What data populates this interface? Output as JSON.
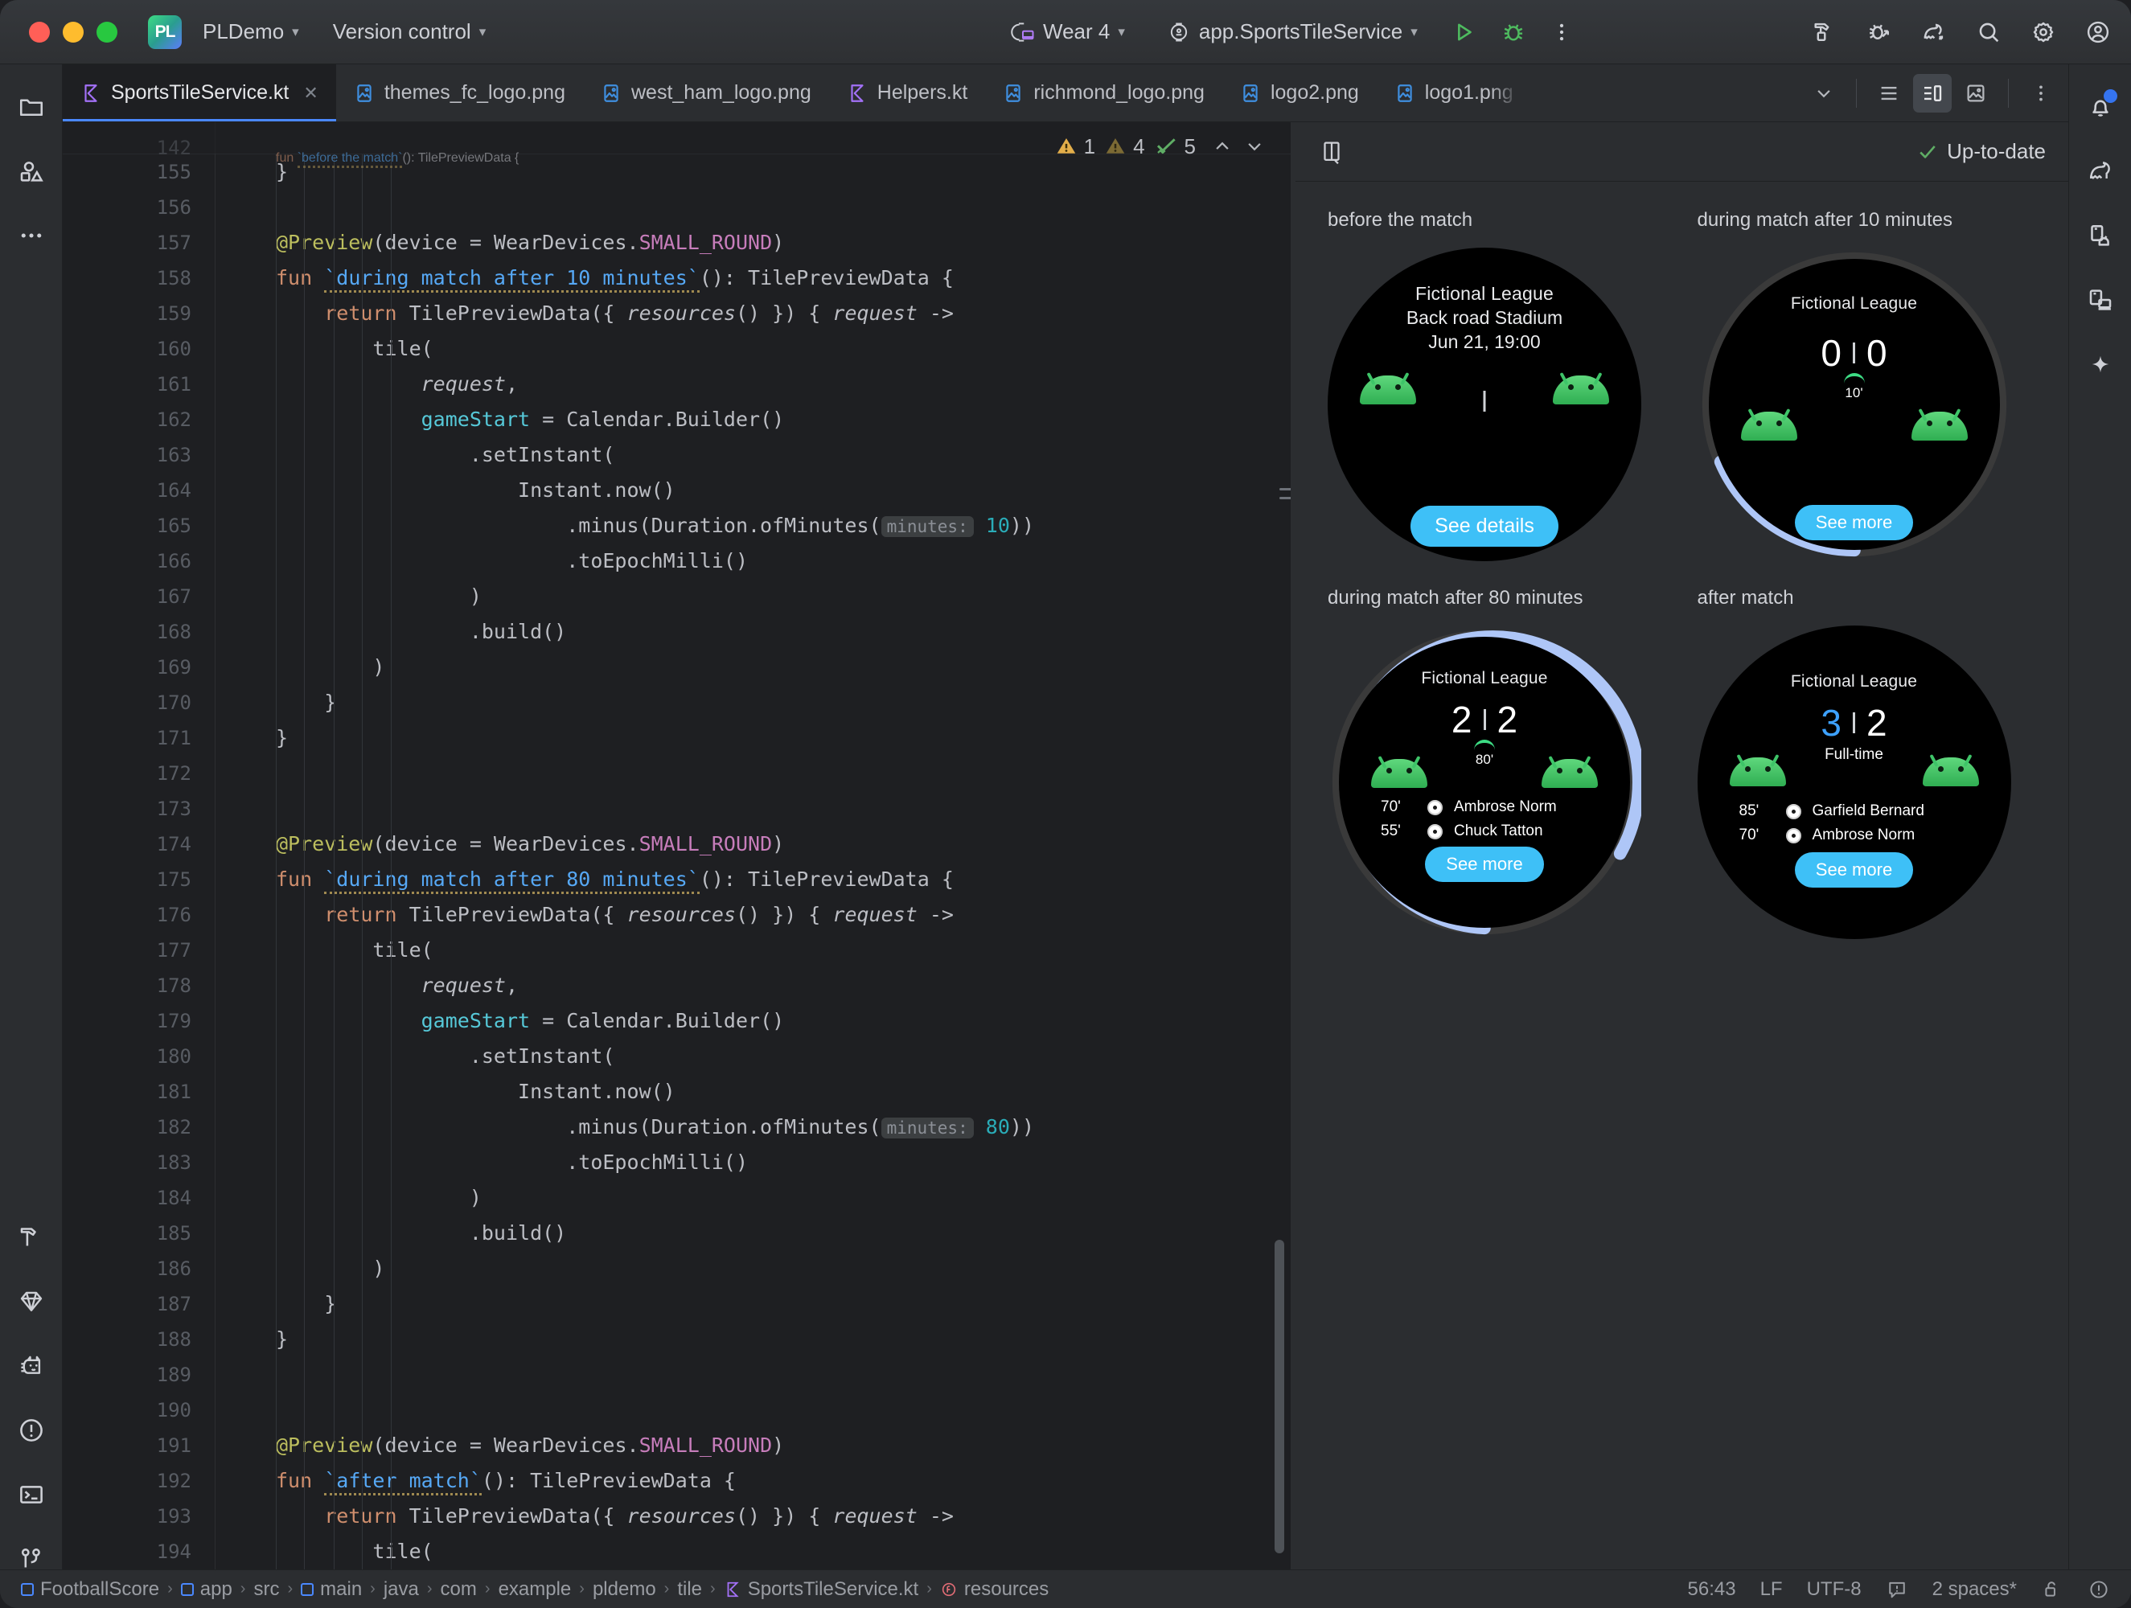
{
  "titlebar": {
    "project_badge": "PL",
    "project_name": "PLDemo",
    "vcs": "Version control",
    "device": "Wear 4",
    "run_config": "app.SportsTileService",
    "icons": {
      "run": "run-icon",
      "debug": "debug-icon",
      "more": "more-vertical-icon",
      "build": "build-hammer-icon",
      "attach_debugger": "attach-debugger-icon",
      "profiler": "profiler-icon",
      "search": "search-icon",
      "settings": "gear-icon",
      "account": "account-icon"
    }
  },
  "left_rail": {
    "top": [
      {
        "name": "project-folder-icon",
        "label": "Project"
      },
      {
        "name": "resource-manager-icon",
        "label": "Resource Manager"
      },
      {
        "name": "more-dots-icon",
        "label": "More tool windows"
      }
    ],
    "bottom": [
      {
        "name": "build-hammer-icon",
        "label": "Build"
      },
      {
        "name": "gemini-diamond-icon",
        "label": "Gemini"
      },
      {
        "name": "logcat-cat-icon",
        "label": "Logcat"
      },
      {
        "name": "problems-warning-icon",
        "label": "Problems"
      },
      {
        "name": "terminal-icon",
        "label": "Terminal"
      },
      {
        "name": "version-control-branch-icon",
        "label": "Version Control"
      }
    ]
  },
  "right_rail": [
    {
      "name": "notifications-bell-icon",
      "label": "Notifications",
      "badge": true
    },
    {
      "name": "profiler-icon",
      "label": "Profiler"
    },
    {
      "name": "device-manager-icon",
      "label": "Device Manager"
    },
    {
      "name": "running-devices-icon",
      "label": "Running Devices"
    },
    {
      "name": "gemini-sparkle-icon",
      "label": "Gemini"
    }
  ],
  "tabs": [
    {
      "label": "SportsTileService.kt",
      "icon": "kotlin-file-icon",
      "active": true,
      "closable": true
    },
    {
      "label": "themes_fc_logo.png",
      "icon": "image-file-icon",
      "active": false,
      "closable": false
    },
    {
      "label": "west_ham_logo.png",
      "icon": "image-file-icon",
      "active": false,
      "closable": false
    },
    {
      "label": "Helpers.kt",
      "icon": "kotlin-file-icon",
      "active": false,
      "closable": false
    },
    {
      "label": "richmond_logo.png",
      "icon": "image-file-icon",
      "active": false,
      "closable": false
    },
    {
      "label": "logo2.png",
      "icon": "image-file-icon",
      "active": false,
      "closable": false
    },
    {
      "label": "logo1.png",
      "icon": "image-file-icon",
      "active": false,
      "closable": false
    }
  ],
  "tabbar_tools": {
    "overflow": "chevron-down-icon",
    "list_view": "list-view-icon",
    "split_view": "split-editor-icon",
    "design_view": "design-preview-icon",
    "more": "more-vertical-icon"
  },
  "editor": {
    "inspections": {
      "warnings_high": "1",
      "warnings_low": "4",
      "checks": "5",
      "up_arrow": "chevron-up-icon",
      "down_arrow": "chevron-down-icon"
    },
    "sticky_line": "142",
    "sticky_text": "fun `before the match`(): TilePreviewData {",
    "lines": [
      {
        "n": "155",
        "t": "}"
      },
      {
        "n": "156",
        "t": ""
      },
      {
        "n": "157",
        "t": "@Preview(device = WearDevices.SMALL_ROUND)"
      },
      {
        "n": "158",
        "t": "fun `during match after 10 minutes`(): TilePreviewData {"
      },
      {
        "n": "159",
        "t": "  return TilePreviewData({ resources() }) { request ->"
      },
      {
        "n": "160",
        "t": "    tile("
      },
      {
        "n": "161",
        "t": "      request,"
      },
      {
        "n": "162",
        "t": "      gameStart = Calendar.Builder()"
      },
      {
        "n": "163",
        "t": "        .setInstant("
      },
      {
        "n": "164",
        "t": "          Instant.now()"
      },
      {
        "n": "165",
        "t": "            .minus(Duration.ofMinutes( minutes: 10))"
      },
      {
        "n": "166",
        "t": "            .toEpochMilli()"
      },
      {
        "n": "167",
        "t": "        )"
      },
      {
        "n": "168",
        "t": "        .build()"
      },
      {
        "n": "169",
        "t": "    )"
      },
      {
        "n": "170",
        "t": "  }"
      },
      {
        "n": "171",
        "t": "}"
      },
      {
        "n": "172",
        "t": ""
      },
      {
        "n": "173",
        "t": ""
      },
      {
        "n": "174",
        "t": "@Preview(device = WearDevices.SMALL_ROUND)"
      },
      {
        "n": "175",
        "t": "fun `during match after 80 minutes`(): TilePreviewData {"
      },
      {
        "n": "176",
        "t": "  return TilePreviewData({ resources() }) { request ->"
      },
      {
        "n": "177",
        "t": "    tile("
      },
      {
        "n": "178",
        "t": "      request,"
      },
      {
        "n": "179",
        "t": "      gameStart = Calendar.Builder()"
      },
      {
        "n": "180",
        "t": "        .setInstant("
      },
      {
        "n": "181",
        "t": "          Instant.now()"
      },
      {
        "n": "182",
        "t": "            .minus(Duration.ofMinutes( minutes: 80))"
      },
      {
        "n": "183",
        "t": "            .toEpochMilli()"
      },
      {
        "n": "184",
        "t": "        )"
      },
      {
        "n": "185",
        "t": "        .build()"
      },
      {
        "n": "186",
        "t": "    )"
      },
      {
        "n": "187",
        "t": "  }"
      },
      {
        "n": "188",
        "t": "}"
      },
      {
        "n": "189",
        "t": ""
      },
      {
        "n": "190",
        "t": ""
      },
      {
        "n": "191",
        "t": "@Preview(device = WearDevices.SMALL_ROUND)"
      },
      {
        "n": "192",
        "t": "fun `after match`(): TilePreviewData {"
      },
      {
        "n": "193",
        "t": "  return TilePreviewData({ resources() }) { request ->"
      },
      {
        "n": "194",
        "t": "    tile("
      }
    ],
    "param_hints": {
      "minutes_label": "minutes:",
      "v10": "10",
      "v80": "80"
    }
  },
  "preview": {
    "layout_icon": "preview-layout-icon",
    "status_text": "Up-to-date",
    "status_icon": "check-icon",
    "previews": [
      {
        "label": "before the match",
        "league": "Fictional League",
        "stadium": "Back road Stadium",
        "datetime": "Jun 21, 19:00",
        "cta": "See details",
        "ring": "none",
        "score_home": null,
        "score_away": null,
        "minute": null,
        "events": []
      },
      {
        "label": "during match after 10 minutes",
        "league": "Fictional League",
        "score_home": "0",
        "score_away": "0",
        "minute": "10'",
        "cta": "See more",
        "ring": "partial-10",
        "events": []
      },
      {
        "label": "during match after 80 minutes",
        "league": "Fictional League",
        "score_home": "2",
        "score_away": "2",
        "minute": "80'",
        "cta": "See more",
        "ring": "partial-80",
        "events": [
          {
            "time": "70'",
            "player": "Ambrose Norm"
          },
          {
            "time": "55'",
            "player": "Chuck Tatton"
          }
        ]
      },
      {
        "label": "after match",
        "league": "Fictional League",
        "score_home": "3",
        "score_away": "2",
        "minute": "Full-time",
        "cta": "See more",
        "ring": "none",
        "home_highlight": true,
        "events": [
          {
            "time": "85'",
            "player": "Garfield Bernard"
          },
          {
            "time": "70'",
            "player": "Ambrose Norm"
          }
        ]
      }
    ]
  },
  "statusbar": {
    "breadcrumbs": [
      {
        "label": "FootballScore",
        "icon": "module-icon"
      },
      {
        "label": "app",
        "icon": "module-icon"
      },
      {
        "label": "src",
        "icon": null
      },
      {
        "label": "main",
        "icon": "module-icon"
      },
      {
        "label": "java",
        "icon": null
      },
      {
        "label": "com",
        "icon": null
      },
      {
        "label": "example",
        "icon": null
      },
      {
        "label": "pldemo",
        "icon": null
      },
      {
        "label": "tile",
        "icon": null
      },
      {
        "label": "SportsTileService.kt",
        "icon": "kotlin-file-icon"
      },
      {
        "label": "resources",
        "icon": "function-icon"
      }
    ],
    "caret": "56:43",
    "line_sep": "LF",
    "encoding": "UTF-8",
    "inspection_icon": "inspection-widget-icon",
    "indent": "2 spaces*",
    "lock_icon": "unlocked-icon",
    "issue_icon": "issue-icon"
  },
  "colors": {
    "accent_blue": "#4a88ff",
    "cta_blue": "#3ec0f7",
    "ring_active": "#aec6f7",
    "ring_track": "#3a3a3a",
    "android_green": "#3ddc84",
    "score_blue": "#3da1ff",
    "warning_amber": "#e3ae4a",
    "check_green": "#5fad65"
  }
}
